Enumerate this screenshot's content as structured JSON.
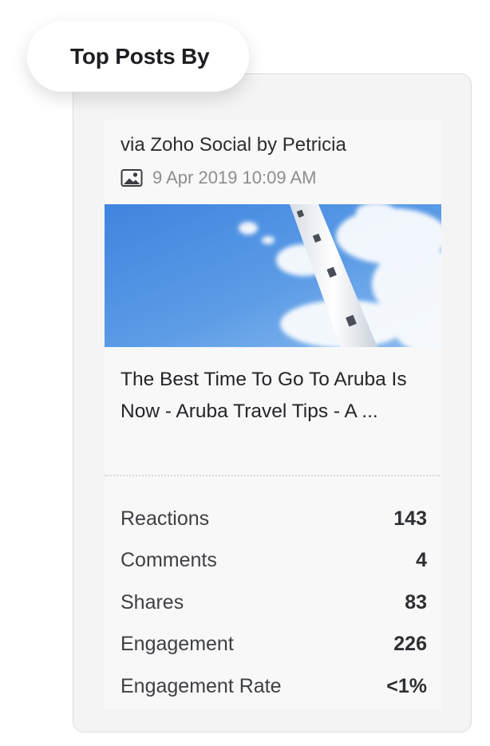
{
  "widget": {
    "title": "Top Posts By"
  },
  "post": {
    "source": "via Zoho Social by Petricia",
    "media_icon": "image-icon",
    "date": "9 Apr 2019 10:09 AM",
    "image_alt": "lighthouse-against-blue-sky",
    "title": "The Best Time To Go To Aruba Is Now - Aruba Travel Tips - A ..."
  },
  "stats": [
    {
      "label": "Reactions",
      "value": "143"
    },
    {
      "label": "Comments",
      "value": "4"
    },
    {
      "label": "Shares",
      "value": "83"
    },
    {
      "label": "Engagement",
      "value": "226"
    },
    {
      "label": "Engagement Rate",
      "value": "<1%"
    }
  ],
  "colors": {
    "card_background": "#f4f4f5",
    "sky": "#4d8fe0",
    "text_primary": "#2b2d31",
    "text_muted": "#8c8d91"
  }
}
